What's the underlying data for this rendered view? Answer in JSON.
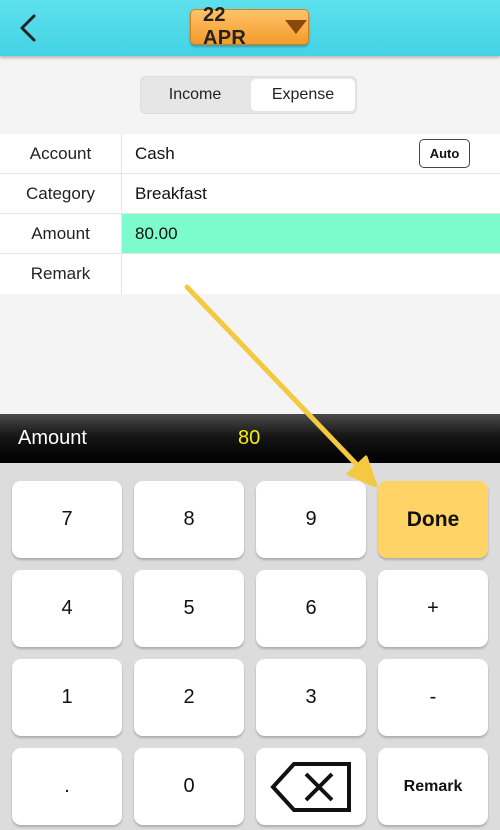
{
  "header": {
    "back_icon": "chevron-left-icon",
    "date_label": "22 APR",
    "date_caret_icon": "triangle-down-icon",
    "accent_color": "#4fd9e8",
    "date_button_color": "#f9a93c"
  },
  "type_toggle": {
    "options": [
      "Income",
      "Expense"
    ],
    "selected": "Expense"
  },
  "form": {
    "rows": [
      {
        "label": "Account",
        "value": "Cash"
      },
      {
        "label": "Category",
        "value": "Breakfast"
      },
      {
        "label": "Amount",
        "value": "80.00"
      },
      {
        "label": "Remark",
        "value": ""
      }
    ],
    "auto_label": "Auto",
    "active_field_color": "#7cfccc"
  },
  "amount_bar": {
    "label": "Amount",
    "value": "80",
    "value_color": "#f6f000"
  },
  "keypad": {
    "keys": [
      "7",
      "8",
      "9",
      "Done",
      "4",
      "5",
      "6",
      "+",
      "1",
      "2",
      "3",
      "-",
      ".",
      "0",
      "backspace-icon",
      "Remark"
    ],
    "done_color": "#ffd366"
  },
  "annotation": {
    "icon": "arrow-icon",
    "color": "#f5c842"
  }
}
